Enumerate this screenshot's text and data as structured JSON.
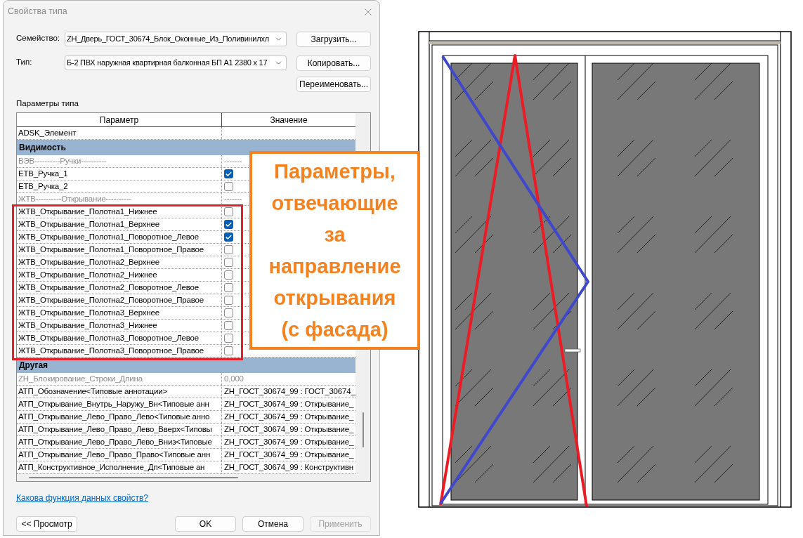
{
  "window": {
    "title": "Свойства типа"
  },
  "family": {
    "label": "Семейство:",
    "value": "ZH_Дверь_ГОСТ_30674_Блок_Оконные_Из_Поливинилхл"
  },
  "type": {
    "label": "Тип:",
    "value": "Б-2 ПВХ наружная квартирная балконная БП А1 2380 x 17"
  },
  "side_buttons": [
    "Загрузить...",
    "Копировать...",
    "Переименовать..."
  ],
  "type_parameters": {
    "title": "Параметры типа",
    "columns": [
      "Параметр",
      "Значение"
    ],
    "rows": [
      {
        "kind": "text",
        "name": "ADSK_Элемент",
        "disabled": false
      },
      {
        "kind": "group",
        "name": "Видимость",
        "disabled": false
      },
      {
        "kind": "text",
        "name": "ВЭВ----------Ручки----------",
        "value": "-------",
        "disabled": true
      },
      {
        "kind": "checkbox",
        "name": "ЕТВ_Ручка_1",
        "checked": true,
        "disabled": false
      },
      {
        "kind": "checkbox",
        "name": "ЕТВ_Ручка_2",
        "checked": false,
        "disabled": false
      },
      {
        "kind": "text",
        "name": "ЖТВ----------Открывание----------",
        "value": "-------",
        "disabled": true
      },
      {
        "kind": "highlighted_block",
        "rows": [
          {
            "kind": "checkbox",
            "name": "ЖТВ_Открывание_Полотна1_Нижнее",
            "checked": false,
            "disabled": false
          },
          {
            "kind": "checkbox",
            "name": "ЖТВ_Открывание_Полотна1_Верхнее",
            "checked": true,
            "disabled": false
          },
          {
            "kind": "checkbox",
            "name": "ЖТВ_Открывание_Полотна1_Поворотное_Левое",
            "checked": true,
            "disabled": false
          },
          {
            "kind": "checkbox",
            "name": "ЖТВ_Открывание_Полотна1_Поворотное_Правое",
            "checked": false,
            "disabled": false
          },
          {
            "kind": "checkbox",
            "name": "ЖТВ_Открывание_Полотна2_Верхнее",
            "checked": false,
            "disabled": false
          },
          {
            "kind": "checkbox",
            "name": "ЖТВ_Открывание_Полотна2_Нижнее",
            "checked": false,
            "disabled": false
          },
          {
            "kind": "checkbox",
            "name": "ЖТВ_Открывание_Полотна2_Поворотное_Левое",
            "checked": false,
            "disabled": false
          },
          {
            "kind": "checkbox",
            "name": "ЖТВ_Открывание_Полотна2_Поворотное_Правое",
            "checked": false,
            "disabled": false
          },
          {
            "kind": "checkbox",
            "name": "ЖТВ_Открывание_Полотна3_Верхнее",
            "checked": false,
            "disabled": false
          },
          {
            "kind": "checkbox",
            "name": "ЖТВ_Открывание_Полотна3_Нижнее",
            "checked": false,
            "disabled": false
          },
          {
            "kind": "checkbox",
            "name": "ЖТВ_Открывание_Полотна3_Поворотное_Левое",
            "checked": false,
            "disabled": false
          },
          {
            "kind": "checkbox",
            "name": "ЖТВ_Открывание_Полотна3_Поворотное_Правое",
            "checked": false,
            "disabled": false
          }
        ]
      },
      {
        "kind": "group",
        "name": "Другая",
        "disabled": false
      },
      {
        "kind": "text",
        "name": "ZH_Блокирование_Строки_Длина",
        "value": "0,000",
        "disabled": true
      },
      {
        "kind": "text",
        "name": "АТП_Обозначение<Типовые аннотации>",
        "value": "ZH_ГОСТ_30674_99 : ГОСТ_30674_",
        "disabled": false
      },
      {
        "kind": "text",
        "name": "АТП_Открывание_Внутрь_Наружу_Вн<Типовые анн",
        "value": "ZH_ГОСТ_30674_99 : Открывание_",
        "disabled": false
      },
      {
        "kind": "text",
        "name": "АТП_Открывание_Лево_Право_Лево<Типовые анно",
        "value": "ZH_ГОСТ_30674_99 : Открывание_",
        "disabled": false
      },
      {
        "kind": "text",
        "name": "АТП_Открывание_Лево_Право_Лево_Вверх<Типовы",
        "value": "ZH_ГОСТ_30674_99 : Открывание_",
        "disabled": false
      },
      {
        "kind": "text",
        "name": "АТП_Открывание_Лево_Право_Лево_Вниз<Типовые",
        "value": "ZH_ГОСТ_30674_99 : Открывание_",
        "disabled": false
      },
      {
        "kind": "text",
        "name": "АТП_Открывание_Лево_Право_Право<Типовые анн",
        "value": "ZH_ГОСТ_30674_99 : Открывание_",
        "disabled": false
      },
      {
        "kind": "text",
        "name": "АТП_Конструктивное_Исполнение_Дп<Типовые ан",
        "value": "ZH_ГОСТ_30674_99 : Конструктивн",
        "disabled": false
      }
    ]
  },
  "help_link": "Какова функция данных свойств?",
  "buttons": [
    {
      "label": "<< Просмотр",
      "disabled": false
    },
    {
      "label": "OK",
      "disabled": false
    },
    {
      "label": "Отмена",
      "disabled": false
    },
    {
      "label": "Применить",
      "disabled": true
    }
  ],
  "callout": {
    "text": "Параметры,\nотвечающие\nза\nнаправление\nоткрывания\n(с фасада)"
  }
}
